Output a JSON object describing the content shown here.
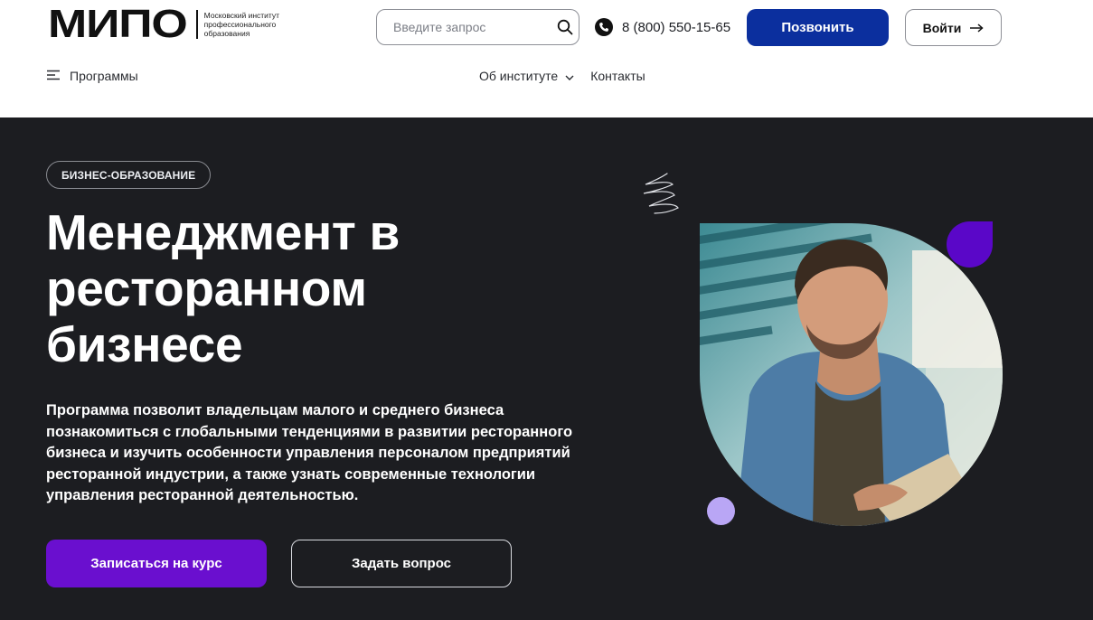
{
  "header": {
    "logo": {
      "mark": "МИПО",
      "subtitle": "Московский институт профессионального образования"
    },
    "search": {
      "placeholder": "Введите запрос",
      "icon": "search-icon"
    },
    "phone": {
      "icon": "phone-icon",
      "number": "8 (800) 550-15-65"
    },
    "call_button": "Позвонить",
    "login_button": "Войти",
    "login_icon": "arrow-right-icon",
    "programs_menu": {
      "icon": "menu-icon",
      "label": "Программы"
    },
    "nav": [
      {
        "label": "Об институте",
        "icon": "chevron-down-icon"
      },
      {
        "label": "Контакты"
      }
    ]
  },
  "hero": {
    "badge": "БИЗНЕС-ОБРАЗОВАНИЕ",
    "title": "Менеджмент в ресторанном бизнесе",
    "description": "Программа позволит владельцам малого и среднего бизнеса познакомиться с глобальными тенденциями в развитии ресторанного бизнеса и изучить особенности управления персоналом предприятий ресторанной индустрии, а также узнать современные технологии управления ресторанной деятельностью.",
    "enroll_button": "Записаться на курс",
    "ask_button": "Задать вопрос"
  },
  "colors": {
    "brand_blue": "#0b2f9e",
    "accent_purple": "#6a0fcf",
    "hero_background": "#1c1d21",
    "dot_lilac": "#b9a6f5"
  }
}
